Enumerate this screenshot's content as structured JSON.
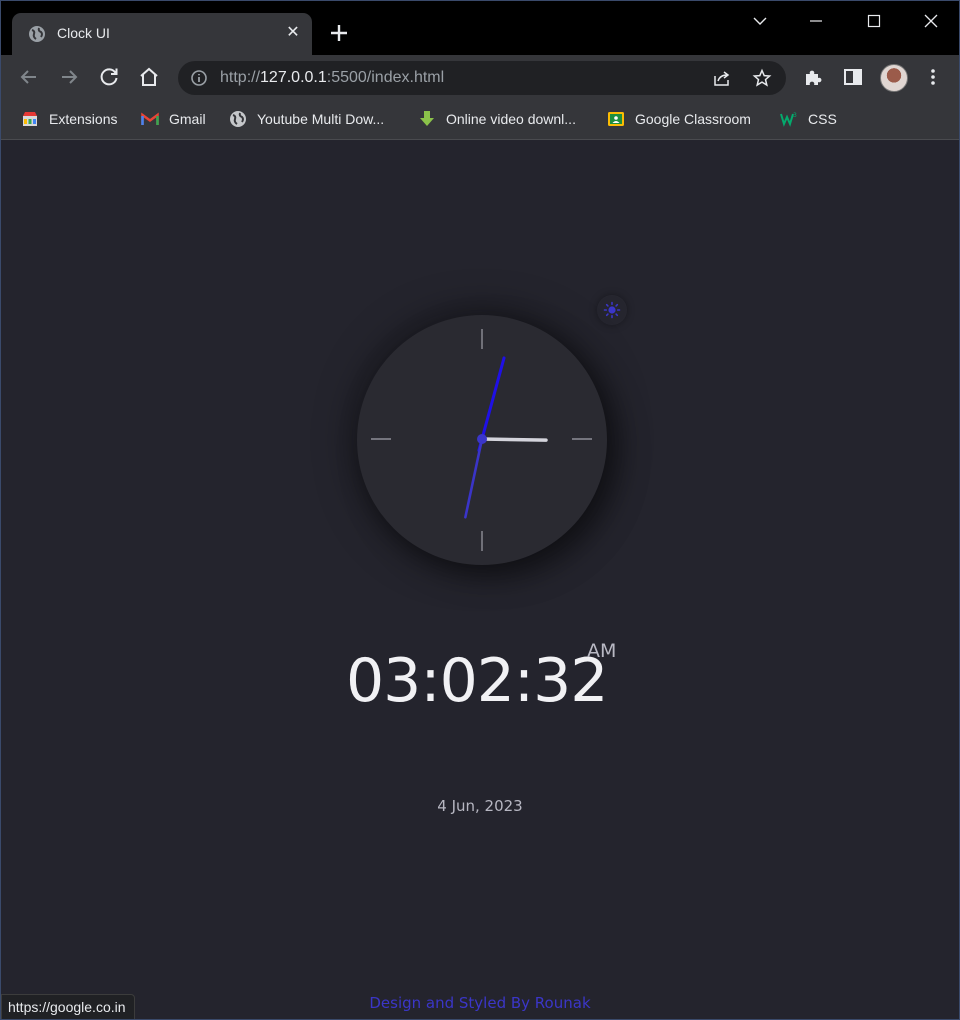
{
  "browser": {
    "tab": {
      "title": "Clock UI",
      "close_glyph": "✕"
    },
    "new_tab_icon": "plus-icon",
    "toolbar": {
      "url_scheme": "http://",
      "url_host": "127.0.0.1",
      "url_path": ":5500/index.html"
    },
    "bookmarks": [
      {
        "label": "Extensions",
        "icon": "extensions-store-icon"
      },
      {
        "label": "Gmail",
        "icon": "gmail-icon"
      },
      {
        "label": "Youtube Multi Dow...",
        "icon": "globe-icon"
      },
      {
        "label": "Online video downl...",
        "icon": "download-arrow-icon"
      },
      {
        "label": "Google Classroom",
        "icon": "classroom-icon"
      },
      {
        "label": "CSS",
        "icon": "w3schools-icon"
      }
    ],
    "status_url": "https://google.co.in"
  },
  "clock": {
    "time": "03:02:32",
    "ampm": "AM",
    "date": "4 Jun, 2023",
    "hands": {
      "hour": 3,
      "minute": 2,
      "second": 32
    },
    "colors": {
      "hour": "#d4d4dc",
      "minute": "#1f10e6",
      "second": "#3a34c8",
      "center": "#3b36c8"
    },
    "theme_icon": "sun-icon"
  },
  "footer": {
    "credit": "Design and Styled By Rounak"
  },
  "colors": {
    "page_bg": "#24242d",
    "accent": "#3b36c8"
  }
}
